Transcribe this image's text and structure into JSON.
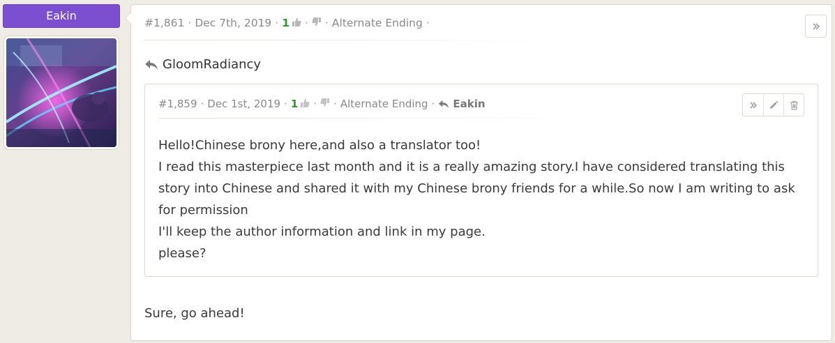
{
  "author": {
    "name": "Eakin"
  },
  "comment": {
    "number": "#1,861",
    "date": "Dec 7th, 2019",
    "score": "1",
    "story": "Alternate Ending",
    "reply_to": "GloomRadiancy",
    "body": "Sure, go ahead!"
  },
  "quote": {
    "number": "#1,859",
    "date": "Dec 1st, 2019",
    "score": "1",
    "story": "Alternate Ending",
    "author": "Eakin",
    "lines": [
      "Hello!Chinese brony here,and also a translator too!",
      "I read this masterpiece last month and it is a really amazing story.I have considered translating this story into Chinese and shared it with my Chinese brony friends for a while.So now I am writing to ask for permission",
      "I'll keep the author information and link in my page.",
      "please?"
    ]
  },
  "separator": "·",
  "icons": {
    "expand": "double-chevron-right-icon",
    "edit": "pencil-icon",
    "delete": "trash-icon",
    "upvote": "thumbs-up-icon",
    "downvote": "thumbs-down-icon",
    "reply": "reply-arrow-icon"
  },
  "colors": {
    "author_badge": "#7b4fd0",
    "score": "#2e9a2e",
    "background": "#efebe5"
  }
}
